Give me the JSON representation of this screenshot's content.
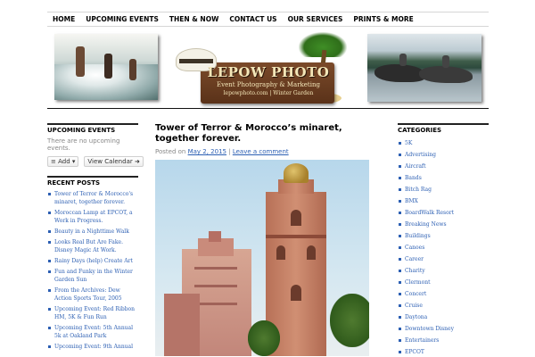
{
  "nav": {
    "items": [
      {
        "label": "HOME"
      },
      {
        "label": "UPCOMING EVENTS"
      },
      {
        "label": "THEN & NOW"
      },
      {
        "label": "CONTACT US"
      },
      {
        "label": "OUR SERVICES"
      },
      {
        "label": "PRINTS & MORE"
      }
    ]
  },
  "header": {
    "logo_title": "LEPOW PHOTO",
    "logo_subtitle": "Event Photography & Marketing",
    "logo_url": "lepowphoto.com | Winter Garden"
  },
  "left_sidebar": {
    "events_title": "UPCOMING EVENTS",
    "no_events_text": "There are no upcoming events.",
    "add_button": "Add",
    "add_icon": "rss-icon",
    "view_calendar_button": "View Calendar",
    "view_calendar_icon": "arrow-right-icon",
    "recent_title": "RECENT POSTS",
    "recent_posts": [
      "Tower of Terror & Morocco's minaret, together forever.",
      "Moroccan Lamp at EPCOT, a Work in Progress.",
      "Beauty in a Nighttime Walk",
      "Looks Real But Are Fake. Disney Magic At Work.",
      "Rainy Days (help) Create Art",
      "Fun and Funky in the Winter Garden Sun",
      "From the Archives: Dew Action Sports Tour, 2005",
      "Upcoming Event: Red Ribbon HM, 5K & Fun Run",
      "Upcoming Event: 5th Annual 5k at Oakland Park",
      "Upcoming Event: 9th Annual"
    ]
  },
  "post": {
    "title": "Tower of Terror & Morocco’s minaret, together forever.",
    "posted_on": "Posted on",
    "date": "May 2, 2015",
    "separator": "|",
    "comment_link": "Leave a comment"
  },
  "right_sidebar": {
    "title": "CATEGORIES",
    "categories": [
      "5K",
      "Advertising",
      "Aircraft",
      "Bands",
      "Bitch Rag",
      "BMX",
      "BoardWalk Resort",
      "Breaking News",
      "Buildings",
      "Canoes",
      "Career",
      "Charity",
      "Clermont",
      "Concert",
      "Cruise",
      "Daytona",
      "Downtown Disney",
      "Entertainers",
      "EPCOT"
    ]
  },
  "colors": {
    "link": "#2c5fb3",
    "nav_text": "#000000",
    "muted_text": "#888888"
  }
}
